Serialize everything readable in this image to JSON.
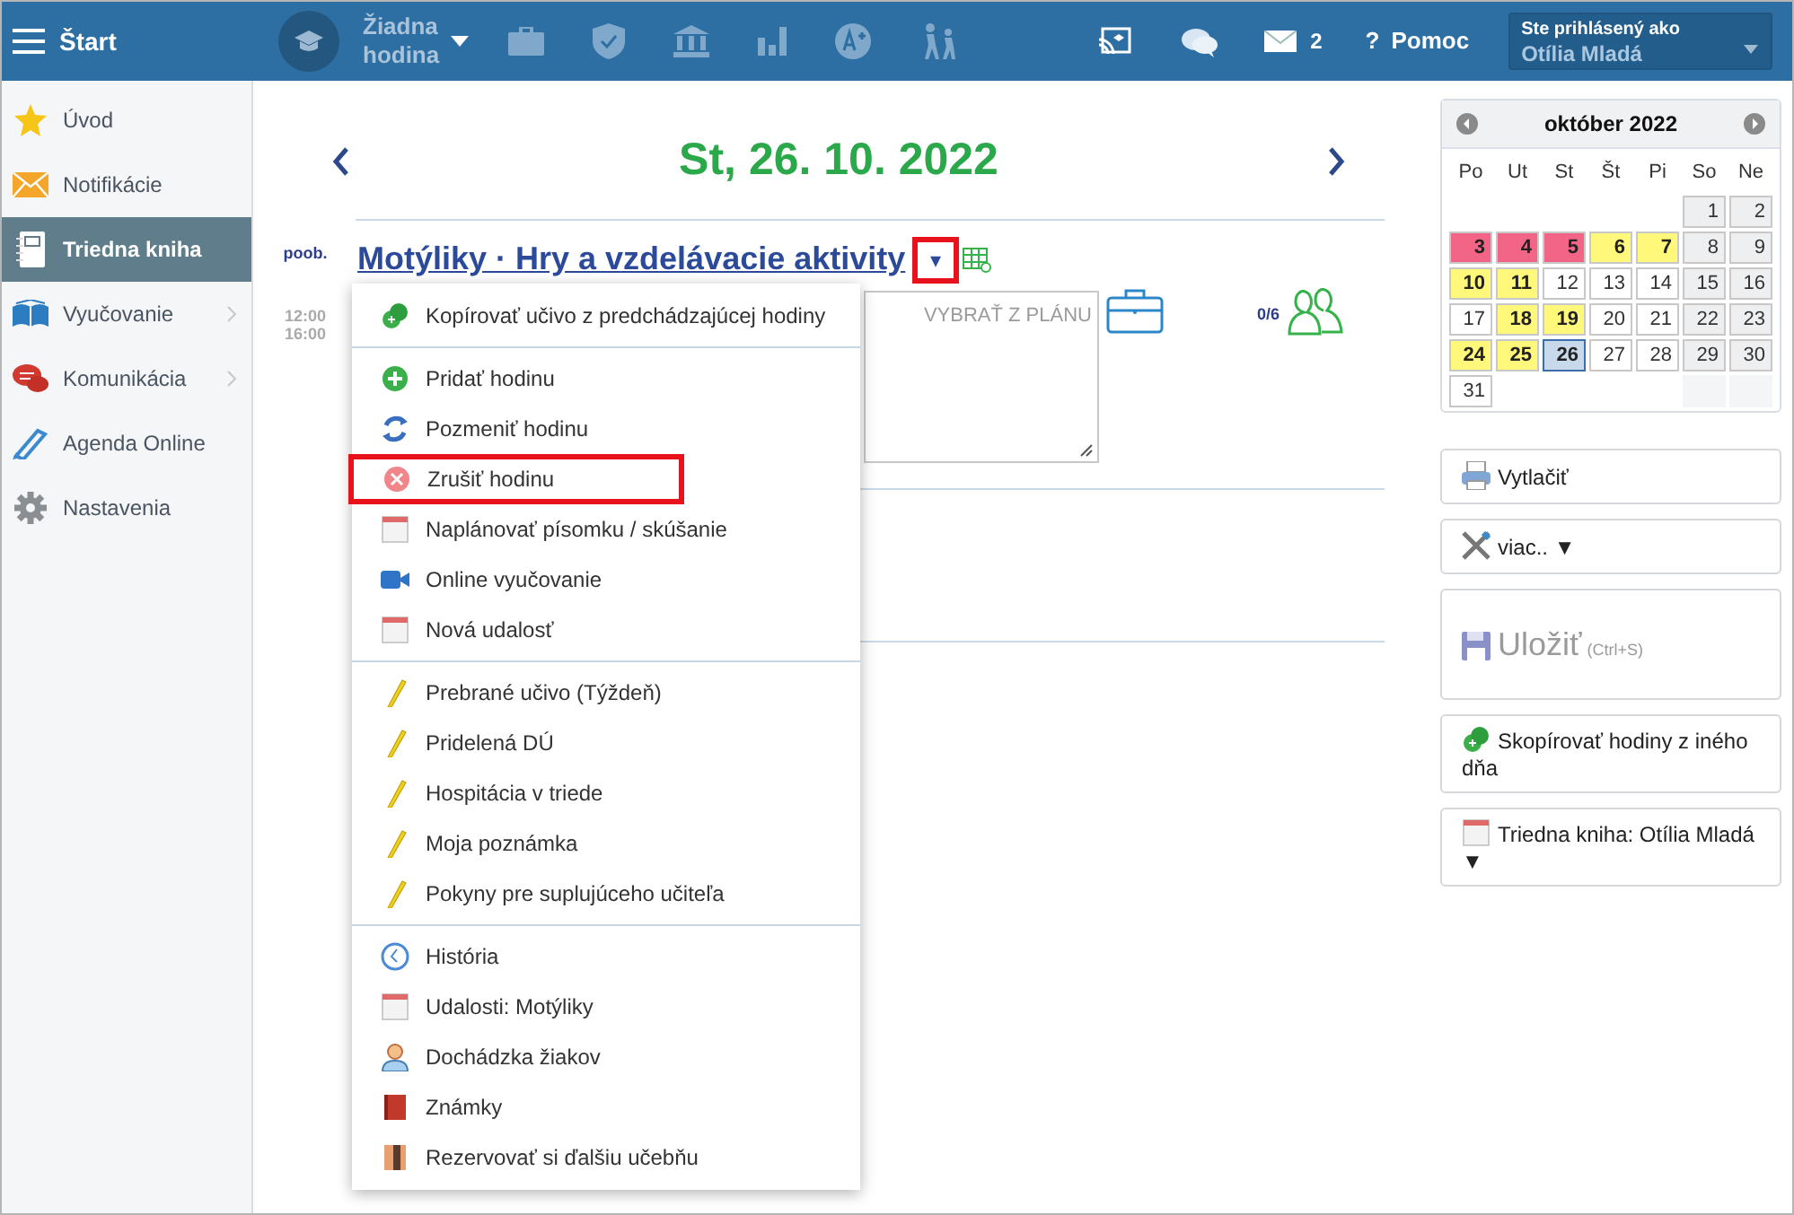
{
  "topbar": {
    "title": "Štart",
    "lesson_picker": {
      "label_lines": [
        "Žiadna",
        "hodina"
      ]
    },
    "mail_count": "2",
    "help": "Pomoc",
    "help_mark": "?",
    "login": {
      "caption": "Ste prihlásený ako",
      "user": "Otília Mladá"
    }
  },
  "sidebar": {
    "items": [
      {
        "label": "Úvod",
        "selected": false,
        "submenu": false
      },
      {
        "label": "Notifikácie",
        "selected": false,
        "submenu": false
      },
      {
        "label": "Triedna kniha",
        "selected": true,
        "submenu": false
      },
      {
        "label": "Vyučovanie",
        "selected": false,
        "submenu": true
      },
      {
        "label": "Komunikácia",
        "selected": false,
        "submenu": true
      },
      {
        "label": "Agenda Online",
        "selected": false,
        "submenu": false
      },
      {
        "label": "Nastavenia",
        "selected": false,
        "submenu": false
      }
    ]
  },
  "day": {
    "date": "St, 26. 10. 2022",
    "lesson": {
      "period": "poob.",
      "start": "12:00",
      "end": "16:00",
      "title": "Motýliky · Hry a vzdelávacie aktivity",
      "toggle_mark": "▾",
      "toggle_annotated": true,
      "plan_button": "VYBRAŤ Z PLÁNU",
      "attendance": "0/6"
    }
  },
  "menu": {
    "groups": [
      [
        {
          "label": "Kopírovať učivo z predchádzajúcej hodiny",
          "annotated": false
        }
      ],
      [
        {
          "label": "Pridať hodinu",
          "annotated": false
        },
        {
          "label": "Pozmeniť hodinu",
          "annotated": false
        },
        {
          "label": "Zrušiť hodinu",
          "annotated": true
        },
        {
          "label": "Naplánovať písomku / skúšanie",
          "annotated": false
        },
        {
          "label": "Online vyučovanie",
          "annotated": false
        },
        {
          "label": "Nová udalosť",
          "annotated": false
        }
      ],
      [
        {
          "label": "Prebrané učivo (Týždeň)",
          "annotated": false
        },
        {
          "label": "Pridelená DÚ",
          "annotated": false
        },
        {
          "label": "Hospitácia v triede",
          "annotated": false
        },
        {
          "label": "Moja poznámka",
          "annotated": false
        },
        {
          "label": "Pokyny pre suplujúceho učiteľa",
          "annotated": false
        }
      ],
      [
        {
          "label": "História",
          "annotated": false
        },
        {
          "label": "Udalosti: Motýliky",
          "annotated": false
        },
        {
          "label": "Dochádzka žiakov",
          "annotated": false
        },
        {
          "label": "Známky",
          "annotated": false
        },
        {
          "label": "Rezervovať si ďalšiu učebňu",
          "annotated": false
        }
      ]
    ]
  },
  "calendar": {
    "month": "október 2022",
    "weekdays": [
      "Po",
      "Ut",
      "St",
      "Št",
      "Pi",
      "So",
      "Ne"
    ],
    "weeks": [
      [
        {
          "day": "1",
          "kind": "weekend",
          "selected": false
        },
        {
          "day": "2",
          "kind": "weekend",
          "selected": false
        }
      ],
      [
        {
          "day": "3",
          "kind": "flagged",
          "selected": false
        },
        {
          "day": "4",
          "kind": "flagged",
          "selected": false
        },
        {
          "day": "5",
          "kind": "flagged",
          "selected": false
        },
        {
          "day": "6",
          "kind": "partial",
          "selected": false
        },
        {
          "day": "7",
          "kind": "partial",
          "selected": false
        },
        {
          "day": "8",
          "kind": "weekend",
          "selected": false
        },
        {
          "day": "9",
          "kind": "weekend",
          "selected": false
        }
      ],
      [
        {
          "day": "10",
          "kind": "partial",
          "selected": false
        },
        {
          "day": "11",
          "kind": "partial",
          "selected": false
        },
        {
          "day": "12",
          "kind": "plain",
          "selected": false
        },
        {
          "day": "13",
          "kind": "plain",
          "selected": false
        },
        {
          "day": "14",
          "kind": "plain",
          "selected": false
        },
        {
          "day": "15",
          "kind": "weekend",
          "selected": false
        },
        {
          "day": "16",
          "kind": "weekend",
          "selected": false
        }
      ],
      [
        {
          "day": "17",
          "kind": "plain",
          "selected": false
        },
        {
          "day": "18",
          "kind": "partial",
          "selected": false
        },
        {
          "day": "19",
          "kind": "partial",
          "selected": false
        },
        {
          "day": "20",
          "kind": "plain",
          "selected": false
        },
        {
          "day": "21",
          "kind": "plain",
          "selected": false
        },
        {
          "day": "22",
          "kind": "weekend",
          "selected": false
        },
        {
          "day": "23",
          "kind": "weekend",
          "selected": false
        }
      ],
      [
        {
          "day": "24",
          "kind": "partial",
          "selected": false
        },
        {
          "day": "25",
          "kind": "partial",
          "selected": false
        },
        {
          "day": "26",
          "kind": "plain",
          "selected": true
        },
        {
          "day": "27",
          "kind": "plain",
          "selected": false
        },
        {
          "day": "28",
          "kind": "plain",
          "selected": false
        },
        {
          "day": "29",
          "kind": "weekend",
          "selected": false
        },
        {
          "day": "30",
          "kind": "weekend",
          "selected": false
        }
      ],
      [
        {
          "day": "31",
          "kind": "plain",
          "selected": false
        }
      ]
    ]
  },
  "actions": [
    {
      "kind": "print",
      "label": "Vytlačiť",
      "disabled": false
    },
    {
      "kind": "more",
      "label": "viac.. ▼",
      "disabled": false
    },
    {
      "kind": "save",
      "label": "Uložiť",
      "shortcut": "(Ctrl+S)",
      "disabled": true
    },
    {
      "kind": "copy",
      "label": "Skopírovať hodiny z iného dňa",
      "disabled": false
    },
    {
      "kind": "book",
      "label": "Triedna kniha: Otília Mladá ▼",
      "disabled": false
    }
  ]
}
